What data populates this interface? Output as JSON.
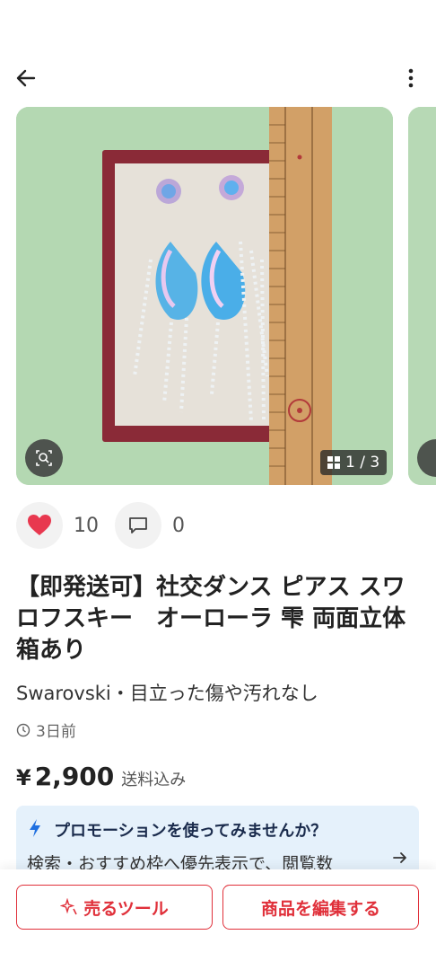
{
  "carousel": {
    "page_indicator": "1 / 3"
  },
  "actions": {
    "likes": "10",
    "comments": "0"
  },
  "product": {
    "title": "【即発送可】社交ダンス ピアス スワロフスキー　オーローラ 雫 両面立体 箱あり",
    "brand": "Swarovski・目立った傷や汚れなし",
    "posted": "3日前",
    "price_symbol": "¥",
    "price": "2,900",
    "shipping": "送料込み"
  },
  "promo": {
    "title": "プロモーションを使ってみませんか？",
    "text": "検索・おすすめ枠へ優先表示で、閲覧数"
  },
  "buttons": {
    "sell_tools": "売るツール",
    "edit": "商品を編集する"
  },
  "colors": {
    "accent": "#e0303a",
    "heart": "#e8384f",
    "promo_bg": "#e5f1fb",
    "promo_icon": "#1f6fe0"
  },
  "icons": [
    "back-arrow-icon",
    "more-vert-icon",
    "lens-search-icon",
    "gallery-grid-icon",
    "heart-icon",
    "comment-icon",
    "clock-icon",
    "bolt-icon",
    "chevron-right-icon",
    "sparkle-icon"
  ]
}
